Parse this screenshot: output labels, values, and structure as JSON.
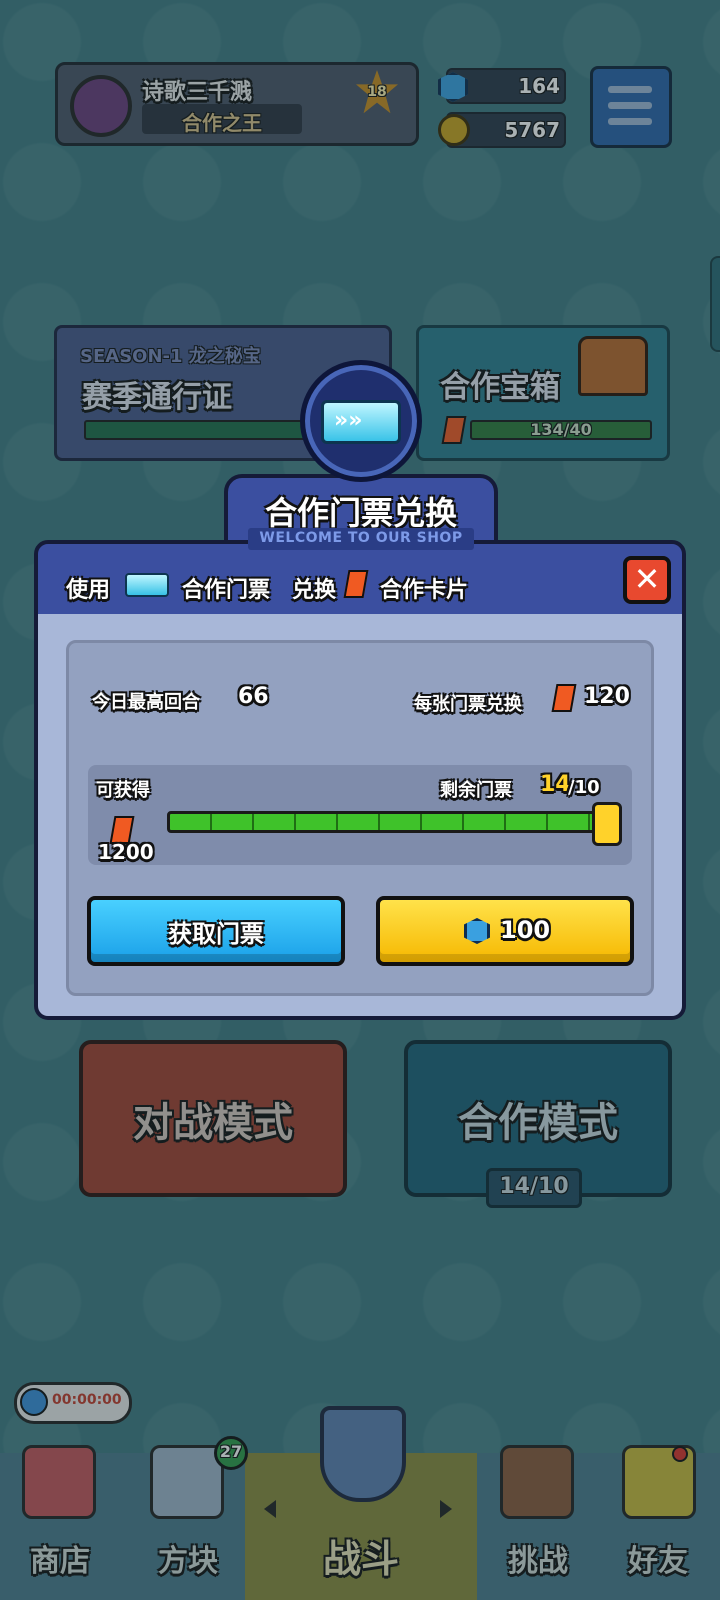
{
  "profile": {
    "name": "诗歌三千溅",
    "title": "合作之王",
    "level": "18"
  },
  "currency": {
    "gems": "164",
    "gold": "5767"
  },
  "season": {
    "label": "SEASON-1 龙之秘宝",
    "pass_label": "赛季通行证"
  },
  "coop_chest": {
    "label": "合作宝箱",
    "progress": "134/40"
  },
  "modes": {
    "battle": "对战模式",
    "coop": "合作模式",
    "coop_tickets": "14/10"
  },
  "timer": "00:00:00",
  "nav": {
    "shop": "商店",
    "blocks": "方块",
    "blocks_badge": "27",
    "battle": "战斗",
    "challenge": "挑战",
    "friends": "好友"
  },
  "dialog": {
    "title": "合作门票兑换",
    "subtitle": "WELCOME TO OUR SHOP",
    "instruction_use": "使用",
    "instruction_ticket": "合作门票",
    "instruction_exchange": "兑换",
    "instruction_card": "合作卡片",
    "today_best_label": "今日最高回合",
    "today_best_value": "66",
    "per_ticket_label": "每张门票兑换",
    "per_ticket_value": "120",
    "obtainable_label": "可获得",
    "obtainable_value": "1200",
    "remaining_label": "剩余门票",
    "remaining_current": "14",
    "remaining_total": "/10",
    "slider_fraction": 1.0,
    "get_tickets_button": "获取门票",
    "buy_button_cost": "100"
  },
  "colors": {
    "accent_blue": "#1aa0e8",
    "accent_yellow": "#f6b800",
    "close_red": "#e8492f",
    "card_orange": "#f05a22"
  }
}
